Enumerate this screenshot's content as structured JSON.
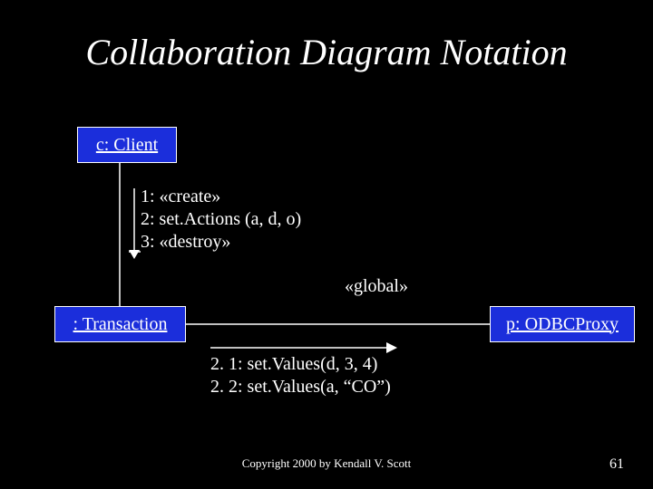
{
  "title": "Collaboration Diagram Notation",
  "objects": {
    "client": "c: Client",
    "transaction": ": Transaction",
    "proxy": "p: ODBCProxy"
  },
  "messages": {
    "top": "1: «create»\n2: set.Actions (a, d, o)\n3: «destroy»",
    "bottom": "2. 1: set.Values(d, 3, 4)\n2. 2: set.Values(a, “CO”)"
  },
  "stereotype": "«global»",
  "copyright": "Copyright 2000 by Kendall V. Scott",
  "page": "61"
}
